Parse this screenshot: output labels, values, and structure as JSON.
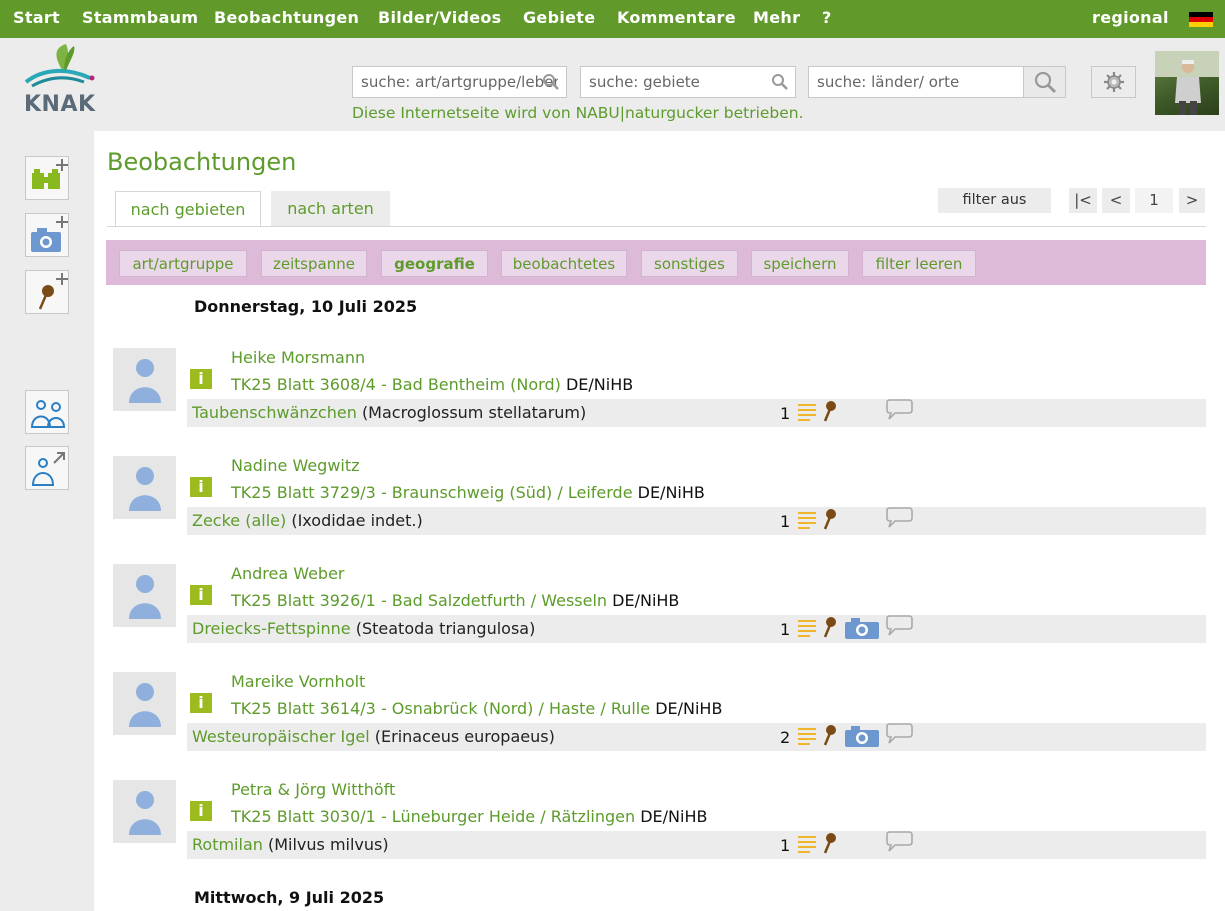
{
  "nav": {
    "items": [
      "Start",
      "Stammbaum",
      "Beobachtungen",
      "Bilder/Videos",
      "Gebiete",
      "Kommentare",
      "Mehr",
      "?"
    ],
    "regional": "regional"
  },
  "logo": {
    "text": "KNAK"
  },
  "search": {
    "species_placeholder": "suche: art/artgruppe/lebensraum",
    "areas_placeholder": "suche: gebiete",
    "places_placeholder": "suche: länder/ orte"
  },
  "notice": "Diese Internetseite wird von NABU|naturgucker betrieben.",
  "page": {
    "title": "Beobachtungen",
    "tabs": [
      "nach gebieten",
      "nach arten"
    ],
    "filter_off": "filter aus",
    "pagination": {
      "first": "|<",
      "prev": "<",
      "page": "1",
      "next": ">"
    }
  },
  "filters": [
    "art/artgruppe",
    "zeitspanne",
    "geografie",
    "beobachtetes",
    "sonstiges",
    "speichern",
    "filter leeren"
  ],
  "dates": [
    "Donnerstag, 10 Juli 2025",
    "Mittwoch, 9 Juli 2025"
  ],
  "observations": [
    {
      "observer": "Heike Morsmann",
      "location": "TK25 Blatt 3608/4 - Bad Bentheim (Nord)",
      "region": "DE/NiHB",
      "species": "Taubenschwänzchen",
      "latin": "(Macroglossum stellatarum)",
      "count": "1",
      "photo": false
    },
    {
      "observer": "Nadine Wegwitz",
      "location": "TK25 Blatt 3729/3 - Braunschweig (Süd) / Leiferde",
      "region": "DE/NiHB",
      "species": "Zecke (alle)",
      "latin": "(Ixodidae indet.)",
      "count": "1",
      "photo": false
    },
    {
      "observer": "Andrea Weber",
      "location": "TK25 Blatt 3926/1 - Bad Salzdetfurth / Wesseln",
      "region": "DE/NiHB",
      "species": "Dreiecks-Fettspinne",
      "latin": "(Steatoda triangulosa)",
      "count": "1",
      "photo": true
    },
    {
      "observer": "Mareike Vornholt",
      "location": "TK25 Blatt 3614/3 - Osnabrück (Nord) / Haste / Rulle",
      "region": "DE/NiHB",
      "species": "Westeuropäischer Igel",
      "latin": "(Erinaceus europaeus)",
      "count": "2",
      "photo": true
    },
    {
      "observer": "Petra & Jörg Witthöft",
      "location": "TK25 Blatt 3030/1 - Lüneburger Heide / Rätzlingen",
      "region": "DE/NiHB",
      "species": "Rotmilan",
      "latin": "(Milvus milvus)",
      "count": "1",
      "photo": false
    }
  ],
  "colors": {
    "nav_green": "#619a2a",
    "link_green": "#5d9b2b",
    "filter_bar": "#dcbad8",
    "info_badge": "#9bbb1f",
    "person_blue": "#8fb0dc",
    "photo_blue": "#6d97cf",
    "list_orange": "#f0b52a",
    "pin_brown": "#7a4b16"
  }
}
